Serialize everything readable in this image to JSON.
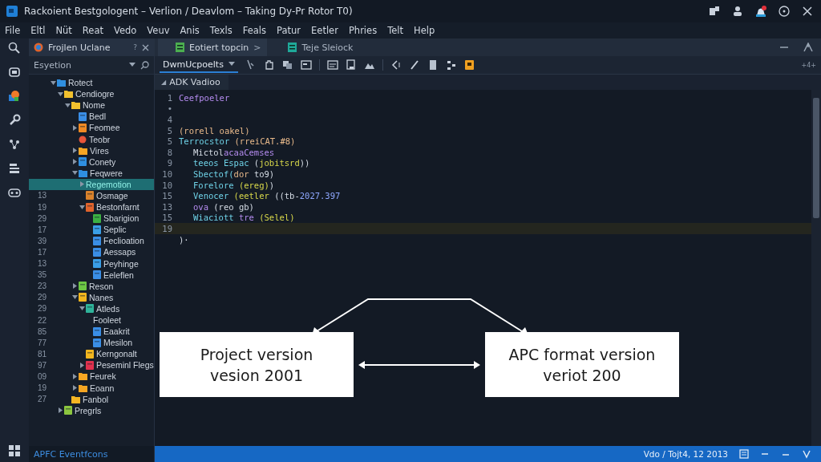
{
  "window": {
    "title": "Rackoient Bestgologent – Verlion / Deavlom – Taking Dy-Pr Rotor T0)"
  },
  "menu": [
    "File",
    "Eltl",
    "Nüt",
    "Reat",
    "Vedo",
    "Veuv",
    "Anis",
    "Texls",
    "Feals",
    "Patur",
    "Eetler",
    "Phries",
    "Telt",
    "Help"
  ],
  "explorer": {
    "tab": "Frojlen Uclane",
    "tab_hint": "?",
    "search": "Esyetion",
    "tree": [
      {
        "label": "Rotect",
        "kind": "folder",
        "color": "#2f8fe0",
        "expanded": true,
        "children": [
          {
            "label": "Cendiogre",
            "kind": "folder",
            "color": "#f2c12e",
            "expanded": true,
            "children": [
              {
                "label": "Nome",
                "kind": "folder",
                "color": "#f2c12e",
                "expanded": true,
                "children": [
                  {
                    "label": "Bedl",
                    "kind": "file",
                    "color": "#3a8ee6"
                  },
                  {
                    "label": "Feomee",
                    "kind": "file",
                    "color": "#f08a24",
                    "expanded": false
                  },
                  {
                    "label": "Teobr",
                    "kind": "dot",
                    "color": "#e8563a"
                  },
                  {
                    "label": "Vires",
                    "kind": "folder",
                    "color": "#f5a623",
                    "expanded": false
                  },
                  {
                    "label": "Conety",
                    "kind": "file",
                    "color": "#2f8fe0",
                    "expanded": false
                  },
                  {
                    "label": "Feqwere",
                    "kind": "folder",
                    "color": "#2f8fe0",
                    "expanded": true,
                    "children": [
                      {
                        "label": "Regemotion",
                        "kind": "none",
                        "selected": true,
                        "expanded": false
                      },
                      {
                        "label": "Osmage",
                        "number": "13",
                        "kind": "file",
                        "color": "#d9822b",
                        "selected": false
                      },
                      {
                        "label": "Bestonfarnt",
                        "number": "19",
                        "kind": "file",
                        "color": "#e0632c",
                        "expanded": true,
                        "children": [
                          {
                            "label": "Sbarigion",
                            "number": "29",
                            "kind": "file",
                            "color": "#3cb043"
                          },
                          {
                            "label": "Seplic",
                            "number": "17",
                            "kind": "file",
                            "color": "#3a9ee6"
                          },
                          {
                            "label": "Feclioation",
                            "number": "39",
                            "kind": "file",
                            "color": "#3a8ee6"
                          },
                          {
                            "label": "Aessaps",
                            "number": "17",
                            "kind": "file",
                            "color": "#3a8ee6"
                          },
                          {
                            "label": "Peyhinge",
                            "number": "13",
                            "kind": "file",
                            "color": "#3a9ee6"
                          },
                          {
                            "label": "Eeleflen",
                            "number": "35",
                            "kind": "file",
                            "color": "#3a8ee6"
                          }
                        ]
                      }
                    ]
                  },
                  {
                    "label": "Reson",
                    "number": "23",
                    "kind": "file",
                    "color": "#6cc644",
                    "expanded": false
                  },
                  {
                    "label": "Nanes",
                    "number": "29",
                    "kind": "file",
                    "color": "#f2b61e",
                    "expanded": true,
                    "children": [
                      {
                        "label": "Atleds",
                        "number": "29",
                        "kind": "file",
                        "color": "#2fb39a",
                        "expanded": true,
                        "children": [
                          {
                            "label": "Fooleet",
                            "number": "22",
                            "kind": "none"
                          },
                          {
                            "label": "Eaakrit",
                            "number": "85",
                            "kind": "file",
                            "color": "#3a8ee6"
                          },
                          {
                            "label": "Mesilon",
                            "number": "77",
                            "kind": "file",
                            "color": "#3a8ee6"
                          }
                        ]
                      },
                      {
                        "label": "Kerngonalt",
                        "number": "81",
                        "kind": "file",
                        "color": "#f2b61e"
                      },
                      {
                        "label": "Peseminl Flegs",
                        "number": "97",
                        "kind": "file",
                        "color": "#e0314e",
                        "expanded": false
                      }
                    ]
                  },
                  {
                    "label": "Feurek",
                    "number": "09",
                    "kind": "folder",
                    "color": "#f5a623",
                    "expanded": false
                  },
                  {
                    "label": "Eoann",
                    "number": "19",
                    "kind": "folder",
                    "color": "#f5a623",
                    "expanded": false
                  }
                ]
              },
              {
                "label": "Fanbol",
                "number": "27",
                "kind": "folder",
                "color": "#f5b623"
              }
            ]
          },
          {
            "label": "Pregrls",
            "kind": "file",
            "color": "#8cc63f",
            "expanded": false
          }
        ]
      }
    ],
    "footer": "APFC Eventfcons"
  },
  "editor_tabs": [
    {
      "label": "Eotiert topcin",
      "selected": true,
      "arrow": ">"
    },
    {
      "label": "Teje Sleiock",
      "selected": false
    }
  ],
  "toolbar": {
    "dropdown": "DwmUcpoelts",
    "right_text": "+4+"
  },
  "file_tab": {
    "marker": "◢",
    "label": "ADK Vadioo"
  },
  "code": [
    {
      "number": "1",
      "tokens": [
        {
          "text": "Ceefpoeler",
          "kind": "name"
        }
      ]
    },
    {
      "number": "•"
    },
    {
      "number": "4"
    },
    {
      "number": "5",
      "tokens": [
        {
          "text": "(rorell oakel)",
          "kind": "text"
        }
      ]
    },
    {
      "number": "5",
      "tokens": [
        {
          "text": "Terrocstor",
          "kind": "keyword"
        },
        {
          "text": " (rreiCAT.#8)",
          "kind": "text"
        }
      ]
    },
    {
      "number": "8",
      "indented": true,
      "tokens": [
        {
          "text": "Mictol",
          "kind": "plain"
        },
        {
          "text": "acaaCemses",
          "kind": "name"
        }
      ]
    },
    {
      "number": "9",
      "indented": true,
      "tokens": [
        {
          "text": "teeos Espac ",
          "kind": "keyword"
        },
        {
          "text": "(",
          "kind": "plain"
        },
        {
          "text": "jobitsrd",
          "kind": "string"
        },
        {
          "text": "))",
          "kind": "plain"
        }
      ]
    },
    {
      "number": "10",
      "indented": true,
      "tokens": [
        {
          "text": "Sbectof(",
          "kind": "keyword"
        },
        {
          "text": "dor ",
          "kind": "text"
        },
        {
          "text": "to9)",
          "kind": "plain"
        }
      ]
    },
    {
      "number": "10",
      "indented": true,
      "tokens": [
        {
          "text": "Forelore ",
          "kind": "keyword"
        },
        {
          "text": "(ereg)",
          "kind": "string"
        },
        {
          "text": ")",
          "kind": "plain"
        }
      ]
    },
    {
      "number": "15",
      "indented": true,
      "tokens": [
        {
          "text": "Venocer ",
          "kind": "keyword"
        },
        {
          "text": "(eetler ",
          "kind": "string"
        },
        {
          "text": "((tb-",
          "kind": "plain"
        },
        {
          "text": "2027.397",
          "kind": "number"
        }
      ]
    },
    {
      "number": "13",
      "indented": true,
      "tokens": [
        {
          "text": " ova ",
          "kind": "name"
        },
        {
          "text": "(reo gb)",
          "kind": "plain"
        }
      ]
    },
    {
      "number": "15",
      "indented": true,
      "tokens": [
        {
          "text": "Wiaciott ",
          "kind": "keyword"
        },
        {
          "text": "tre ",
          "kind": "name"
        },
        {
          "text": "(Selel)",
          "kind": "string"
        }
      ]
    },
    {
      "number": "19",
      "current": true
    },
    {
      "tokens": [
        {
          "text": ")·",
          "kind": "plain"
        }
      ]
    }
  ],
  "diagram": {
    "left": [
      "Project version",
      "vesion 2001"
    ],
    "right": [
      "APC format version",
      "veriot 200"
    ]
  },
  "status_bar": {
    "text": "Vdo / Tojt4, 12 2013"
  }
}
